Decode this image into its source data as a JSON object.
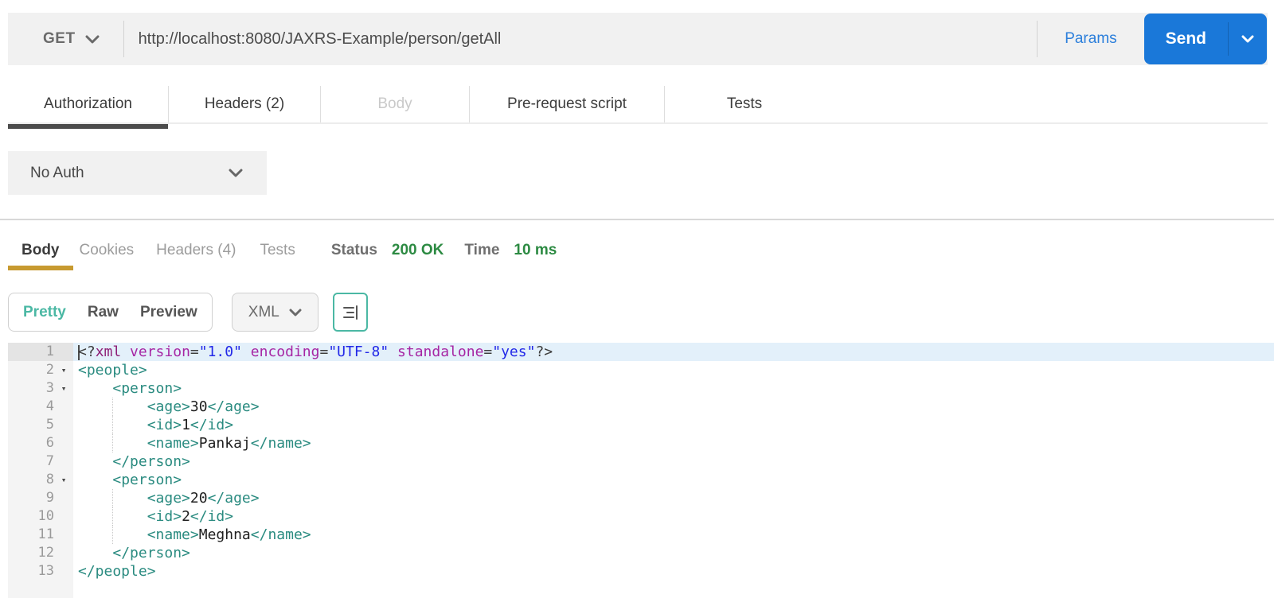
{
  "request": {
    "method": "GET",
    "url": "http://localhost:8080/JAXRS-Example/person/getAll",
    "params_label": "Params",
    "send_label": "Send",
    "tabs": [
      {
        "label": "Authorization",
        "state": "active"
      },
      {
        "label": "Headers (2)",
        "state": "normal"
      },
      {
        "label": "Body",
        "state": "disabled"
      },
      {
        "label": "Pre-request script",
        "state": "normal"
      },
      {
        "label": "Tests",
        "state": "normal"
      }
    ],
    "auth_selected": "No Auth"
  },
  "response": {
    "tabs": [
      {
        "label": "Body",
        "state": "active"
      },
      {
        "label": "Cookies",
        "state": "normal"
      },
      {
        "label": "Headers (4)",
        "state": "normal"
      },
      {
        "label": "Tests",
        "state": "normal"
      }
    ],
    "status_label": "Status",
    "status_value": "200 OK",
    "time_label": "Time",
    "time_value": "10 ms",
    "view_modes": [
      "Pretty",
      "Raw",
      "Preview"
    ],
    "active_view": "Pretty",
    "language": "XML"
  },
  "icons": {
    "chevron-down": "v-shaped chevron",
    "beautify": "align-right lines with vertical bar"
  },
  "colors": {
    "topbar_bg": "#f1f1f1",
    "send_button": "#1a78d9",
    "params_link": "#2c7fdb",
    "active_tab_underline": "#4c4c4c",
    "body_tab_underline": "#c79a30",
    "status_green": "#2c8a42",
    "pretty_teal": "#4bb8a4",
    "active_line_bg": "#e3f0fa",
    "code_tag": "#2a8b80",
    "code_attr": "#a626a4",
    "code_string": "#2228e8",
    "code_meta": "#8e2077"
  },
  "code": {
    "lines": [
      {
        "n": 1,
        "active": true,
        "cursor": true,
        "segs": [
          [
            "p",
            "<?"
          ],
          [
            "m",
            "xml"
          ],
          [
            "x",
            " "
          ],
          [
            "a",
            "version"
          ],
          [
            "p",
            "="
          ],
          [
            "s",
            "\"1.0\""
          ],
          [
            "x",
            " "
          ],
          [
            "a",
            "encoding"
          ],
          [
            "p",
            "="
          ],
          [
            "s",
            "\"UTF-8\""
          ],
          [
            "x",
            " "
          ],
          [
            "a",
            "standalone"
          ],
          [
            "p",
            "="
          ],
          [
            "s",
            "\"yes\""
          ],
          [
            "p",
            "?>"
          ]
        ]
      },
      {
        "n": 2,
        "fold": true,
        "segs": [
          [
            "t",
            "<people>"
          ]
        ]
      },
      {
        "n": 3,
        "fold": true,
        "segs": [
          [
            "x",
            "    "
          ],
          [
            "t",
            "<person>"
          ]
        ]
      },
      {
        "n": 4,
        "guide": true,
        "segs": [
          [
            "x",
            "        "
          ],
          [
            "t",
            "<age>"
          ],
          [
            "x",
            "30"
          ],
          [
            "t",
            "</age>"
          ]
        ]
      },
      {
        "n": 5,
        "guide": true,
        "segs": [
          [
            "x",
            "        "
          ],
          [
            "t",
            "<id>"
          ],
          [
            "x",
            "1"
          ],
          [
            "t",
            "</id>"
          ]
        ]
      },
      {
        "n": 6,
        "guide": true,
        "segs": [
          [
            "x",
            "        "
          ],
          [
            "t",
            "<name>"
          ],
          [
            "x",
            "Pankaj"
          ],
          [
            "t",
            "</name>"
          ]
        ]
      },
      {
        "n": 7,
        "segs": [
          [
            "x",
            "    "
          ],
          [
            "t",
            "</person>"
          ]
        ]
      },
      {
        "n": 8,
        "fold": true,
        "segs": [
          [
            "x",
            "    "
          ],
          [
            "t",
            "<person>"
          ]
        ]
      },
      {
        "n": 9,
        "guide": true,
        "segs": [
          [
            "x",
            "        "
          ],
          [
            "t",
            "<age>"
          ],
          [
            "x",
            "20"
          ],
          [
            "t",
            "</age>"
          ]
        ]
      },
      {
        "n": 10,
        "guide": true,
        "segs": [
          [
            "x",
            "        "
          ],
          [
            "t",
            "<id>"
          ],
          [
            "x",
            "2"
          ],
          [
            "t",
            "</id>"
          ]
        ]
      },
      {
        "n": 11,
        "guide": true,
        "segs": [
          [
            "x",
            "        "
          ],
          [
            "t",
            "<name>"
          ],
          [
            "x",
            "Meghna"
          ],
          [
            "t",
            "</name>"
          ]
        ]
      },
      {
        "n": 12,
        "segs": [
          [
            "x",
            "    "
          ],
          [
            "t",
            "</person>"
          ]
        ]
      },
      {
        "n": 13,
        "segs": [
          [
            "t",
            "</people>"
          ]
        ]
      }
    ]
  }
}
